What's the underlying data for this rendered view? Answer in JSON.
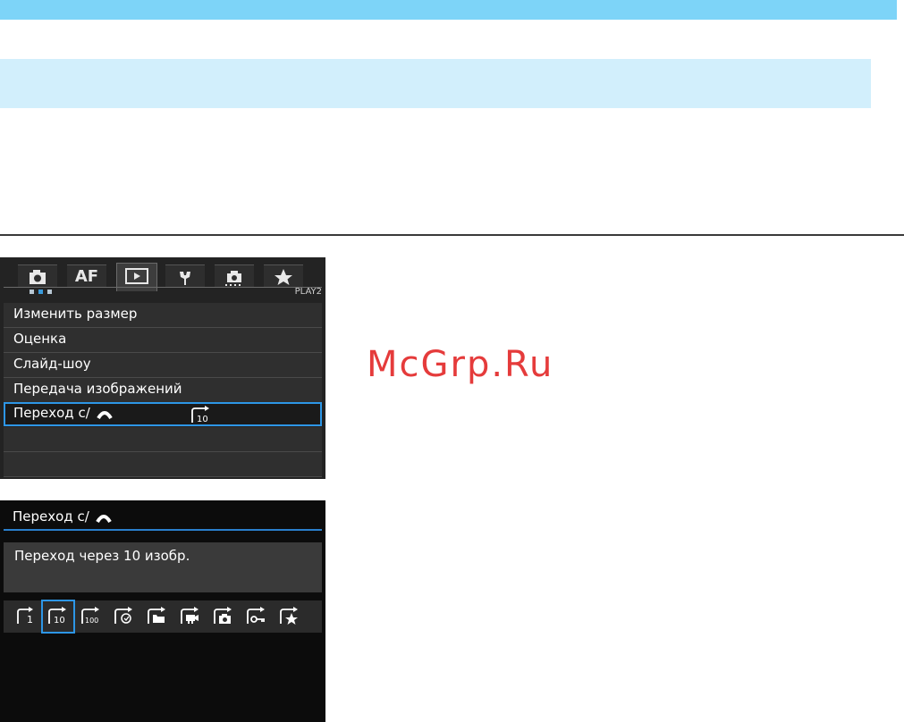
{
  "menu_screen": {
    "tabs": [
      "camera-icon",
      "AF",
      "play-icon",
      "wrench-icon",
      "custom-function-icon",
      "star-icon"
    ],
    "active_tab": 2,
    "page_label": "PLAY2",
    "items": [
      {
        "label": "Изменить размер"
      },
      {
        "label": "Оценка"
      },
      {
        "label": "Слайд-шоу"
      },
      {
        "label": "Передача изображений"
      },
      {
        "label": "Переход с/",
        "value_icon": "jump-10-icon",
        "selected": true
      },
      {
        "label": ""
      },
      {
        "label": ""
      }
    ]
  },
  "jump_screen": {
    "title": "Переход с/",
    "description": "Переход через 10 изобр.",
    "options": [
      "jump-1-icon",
      "jump-10-icon",
      "jump-100-icon",
      "jump-date-icon",
      "jump-folder-icon",
      "jump-movie-icon",
      "jump-still-icon",
      "jump-protect-icon",
      "jump-rating-icon"
    ],
    "selected_option": 1
  },
  "watermark": "McGrp.Ru",
  "colors": {
    "accent": "#2d96e6",
    "header_bar": "#7dd4f8",
    "watermark": "#e53b3b"
  }
}
